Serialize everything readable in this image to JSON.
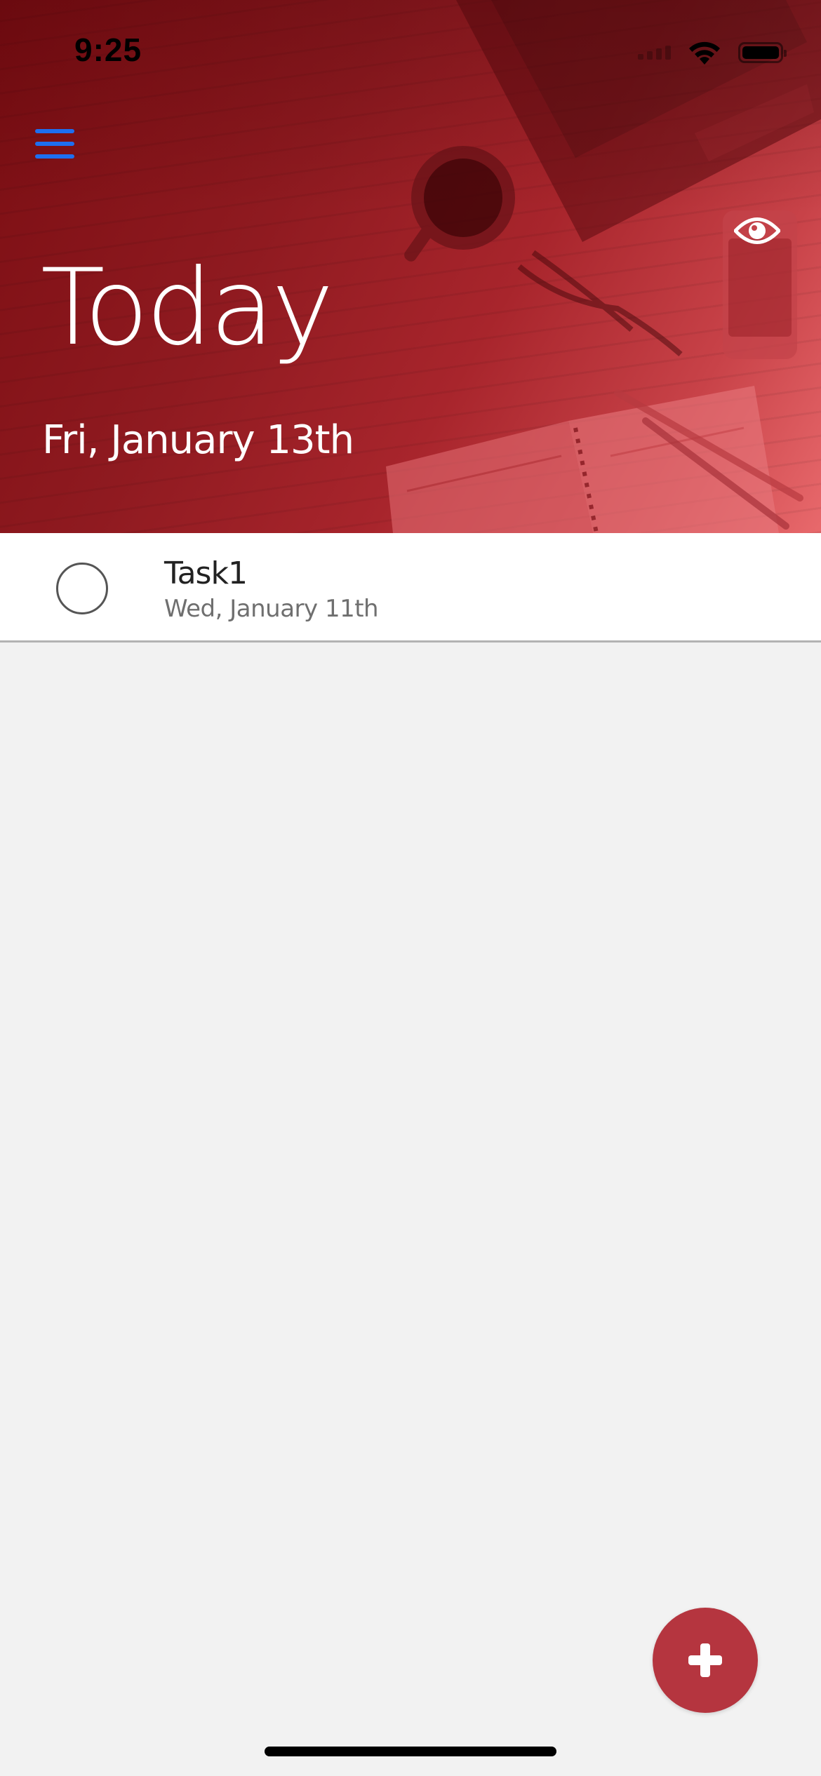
{
  "status_bar": {
    "time": "9:25"
  },
  "header": {
    "title": "Today",
    "date": "Fri, January 13th"
  },
  "tasks": [
    {
      "name": "Task1",
      "date": "Wed, January 11th",
      "completed": false
    }
  ],
  "icons": {
    "menu": "hamburger-menu-icon",
    "visibility": "eye-icon",
    "add": "plus-icon",
    "task_check": "empty-circle-icon"
  },
  "colors": {
    "header_red": "#8f1a20",
    "accent_blue": "#1e6ff0",
    "fab_red": "#b5353f",
    "background": "#f2f2f2"
  }
}
